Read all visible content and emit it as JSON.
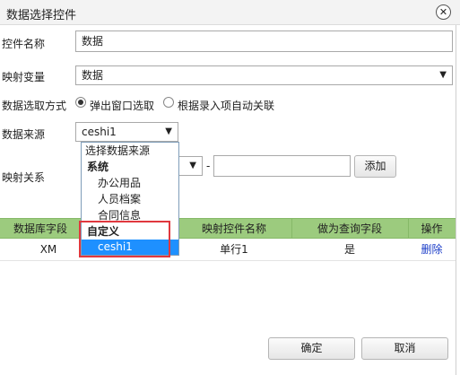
{
  "dialog": {
    "title": "数据选择控件",
    "close_icon_glyph": "✕"
  },
  "form": {
    "control_name_label": "控件名称",
    "control_name_value": "数据",
    "mapping_var_label": "映射变量",
    "mapping_var_value": "数据",
    "data_mode_label": "数据选取方式",
    "mode_options": [
      {
        "label": "弹出窗口选取",
        "checked": true
      },
      {
        "label": "根据录入项自动关联",
        "checked": false
      }
    ],
    "data_source_label": "数据来源",
    "data_source_value": "ceshi1",
    "mapping_relation_label": "映射关系",
    "dash": "-",
    "add_button": "添加"
  },
  "dropdown": {
    "items": [
      {
        "label": "选择数据来源",
        "kind": "placeholder"
      },
      {
        "label": "系统",
        "kind": "group"
      },
      {
        "label": "办公用品",
        "kind": "item"
      },
      {
        "label": "人员档案",
        "kind": "item"
      },
      {
        "label": "合同信息",
        "kind": "item"
      },
      {
        "label": "自定义",
        "kind": "group"
      },
      {
        "label": "ceshi1",
        "kind": "item",
        "selected": true
      }
    ],
    "highlight_color": "#1e90ff"
  },
  "table": {
    "columns": [
      "数据库字段",
      "映射控件名称",
      "做为查询字段",
      "操作"
    ],
    "rows": [
      {
        "db_field": "XM",
        "control": "单行1",
        "query": "是",
        "action": "删除"
      }
    ],
    "header_color": "#9ccb7e"
  },
  "footer": {
    "ok": "确定",
    "cancel": "取消"
  }
}
